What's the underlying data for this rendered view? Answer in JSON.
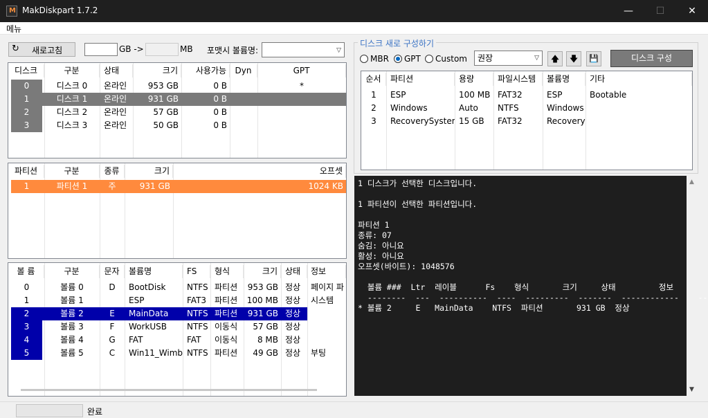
{
  "app": {
    "title": "MakDiskpart 1.7.2",
    "controls": {
      "minimize": "—",
      "maximize": "☐",
      "close": "✕"
    }
  },
  "menu": {
    "label": "메뉴"
  },
  "toolbar": {
    "refresh_label": "새로고침",
    "gb_arrow": "GB ->",
    "mb": "MB",
    "format_label": "포맷시 볼륨명:"
  },
  "disks": {
    "headers": [
      "디스크",
      "구분",
      "상태",
      "크기",
      "사용가능",
      "Dyn",
      "GPT"
    ],
    "rows": [
      {
        "num": "0",
        "name": "디스크 0",
        "status": "온라인",
        "size": "953 GB",
        "free": "0 B",
        "dyn": "",
        "gpt": "*",
        "selected": false
      },
      {
        "num": "1",
        "name": "디스크 1",
        "status": "온라인",
        "size": "931 GB",
        "free": "0 B",
        "dyn": "",
        "gpt": "",
        "selected": true
      },
      {
        "num": "2",
        "name": "디스크 2",
        "status": "온라인",
        "size": "57 GB",
        "free": "0 B",
        "dyn": "",
        "gpt": "",
        "selected": false
      },
      {
        "num": "3",
        "name": "디스크 3",
        "status": "온라인",
        "size": "50 GB",
        "free": "0 B",
        "dyn": "",
        "gpt": "",
        "selected": false
      }
    ]
  },
  "partitions": {
    "headers": [
      "파티션",
      "구분",
      "종류",
      "크기",
      "오프셋"
    ],
    "rows": [
      {
        "num": "1",
        "name": "파티션 1",
        "type": "주",
        "size": "931 GB",
        "offset": "1024 KB"
      }
    ]
  },
  "volumes": {
    "headers": [
      "볼 륨",
      "구분",
      "문자",
      "볼륨명",
      "FS",
      "형식",
      "크기",
      "상태",
      "정보"
    ],
    "rows": [
      {
        "num": "0",
        "name": "볼륨 0",
        "ltr": "D",
        "label": "BootDisk",
        "fs": "NTFS",
        "type": "파티션",
        "size": "953 GB",
        "status": "정상",
        "info": "페이지 파",
        "selected": false
      },
      {
        "num": "1",
        "name": "볼륨 1",
        "ltr": "",
        "label": "ESP",
        "fs": "FAT3",
        "type": "파티션",
        "size": "100 MB",
        "status": "정상",
        "info": "시스템",
        "selected": false
      },
      {
        "num": "2",
        "name": "볼륨 2",
        "ltr": "E",
        "label": "MainData",
        "fs": "NTFS",
        "type": "파티션",
        "size": "931 GB",
        "status": "정상",
        "info": "",
        "selected": true
      },
      {
        "num": "3",
        "name": "볼륨 3",
        "ltr": "F",
        "label": "WorkUSB",
        "fs": "NTFS",
        "type": "이동식",
        "size": "57 GB",
        "status": "정상",
        "info": "",
        "selected": false
      },
      {
        "num": "4",
        "name": "볼륨 4",
        "ltr": "G",
        "label": "FAT",
        "fs": "FAT",
        "type": "이동식",
        "size": "8 MB",
        "status": "정상",
        "info": "",
        "selected": false
      },
      {
        "num": "5",
        "name": "볼륨 5",
        "ltr": "C",
        "label": "Win11_Wimb",
        "fs": "NTFS",
        "type": "파티션",
        "size": "49 GB",
        "status": "정상",
        "info": "부팅",
        "selected": false
      }
    ]
  },
  "reconfig": {
    "title": "디스크 새로 구성하기",
    "mbr": "MBR",
    "gpt": "GPT",
    "custom": "Custom",
    "preset": "권장",
    "up": "🡅",
    "down": "🡇",
    "save": "💾",
    "build_label": "디스크 구성",
    "headers": [
      "순서",
      "파티션",
      "용량",
      "파일시스템",
      "볼륨명",
      "기타"
    ],
    "rows": [
      {
        "order": "1",
        "name": "ESP",
        "size": "100 MB",
        "fs": "FAT32",
        "label": "ESP",
        "etc": "Bootable"
      },
      {
        "order": "2",
        "name": "Windows",
        "size": "Auto",
        "fs": "NTFS",
        "label": "Windows",
        "etc": ""
      },
      {
        "order": "3",
        "name": "RecoverySystem",
        "size": "15 GB",
        "fs": "FAT32",
        "label": "Recovery",
        "etc": ""
      }
    ]
  },
  "console": {
    "text": "1 디스크가 선택한 디스크입니다.\n\n1 파티션이 선택한 파티션입니다.\n\n파티션 1\n종류: 07\n숨김: 아니요\n활성: 아니요\n오프셋(바이트): 1048576\n\n  볼륨 ###  Ltr  레이블      Fs    형식       크기     상태         정보\n  --------  ---  ----------  ----  ---------  -------  ------------  --------\n* 볼륨 2     E   MainData    NTFS  파티션       931 GB  정상"
  },
  "status": {
    "text": "완료"
  }
}
